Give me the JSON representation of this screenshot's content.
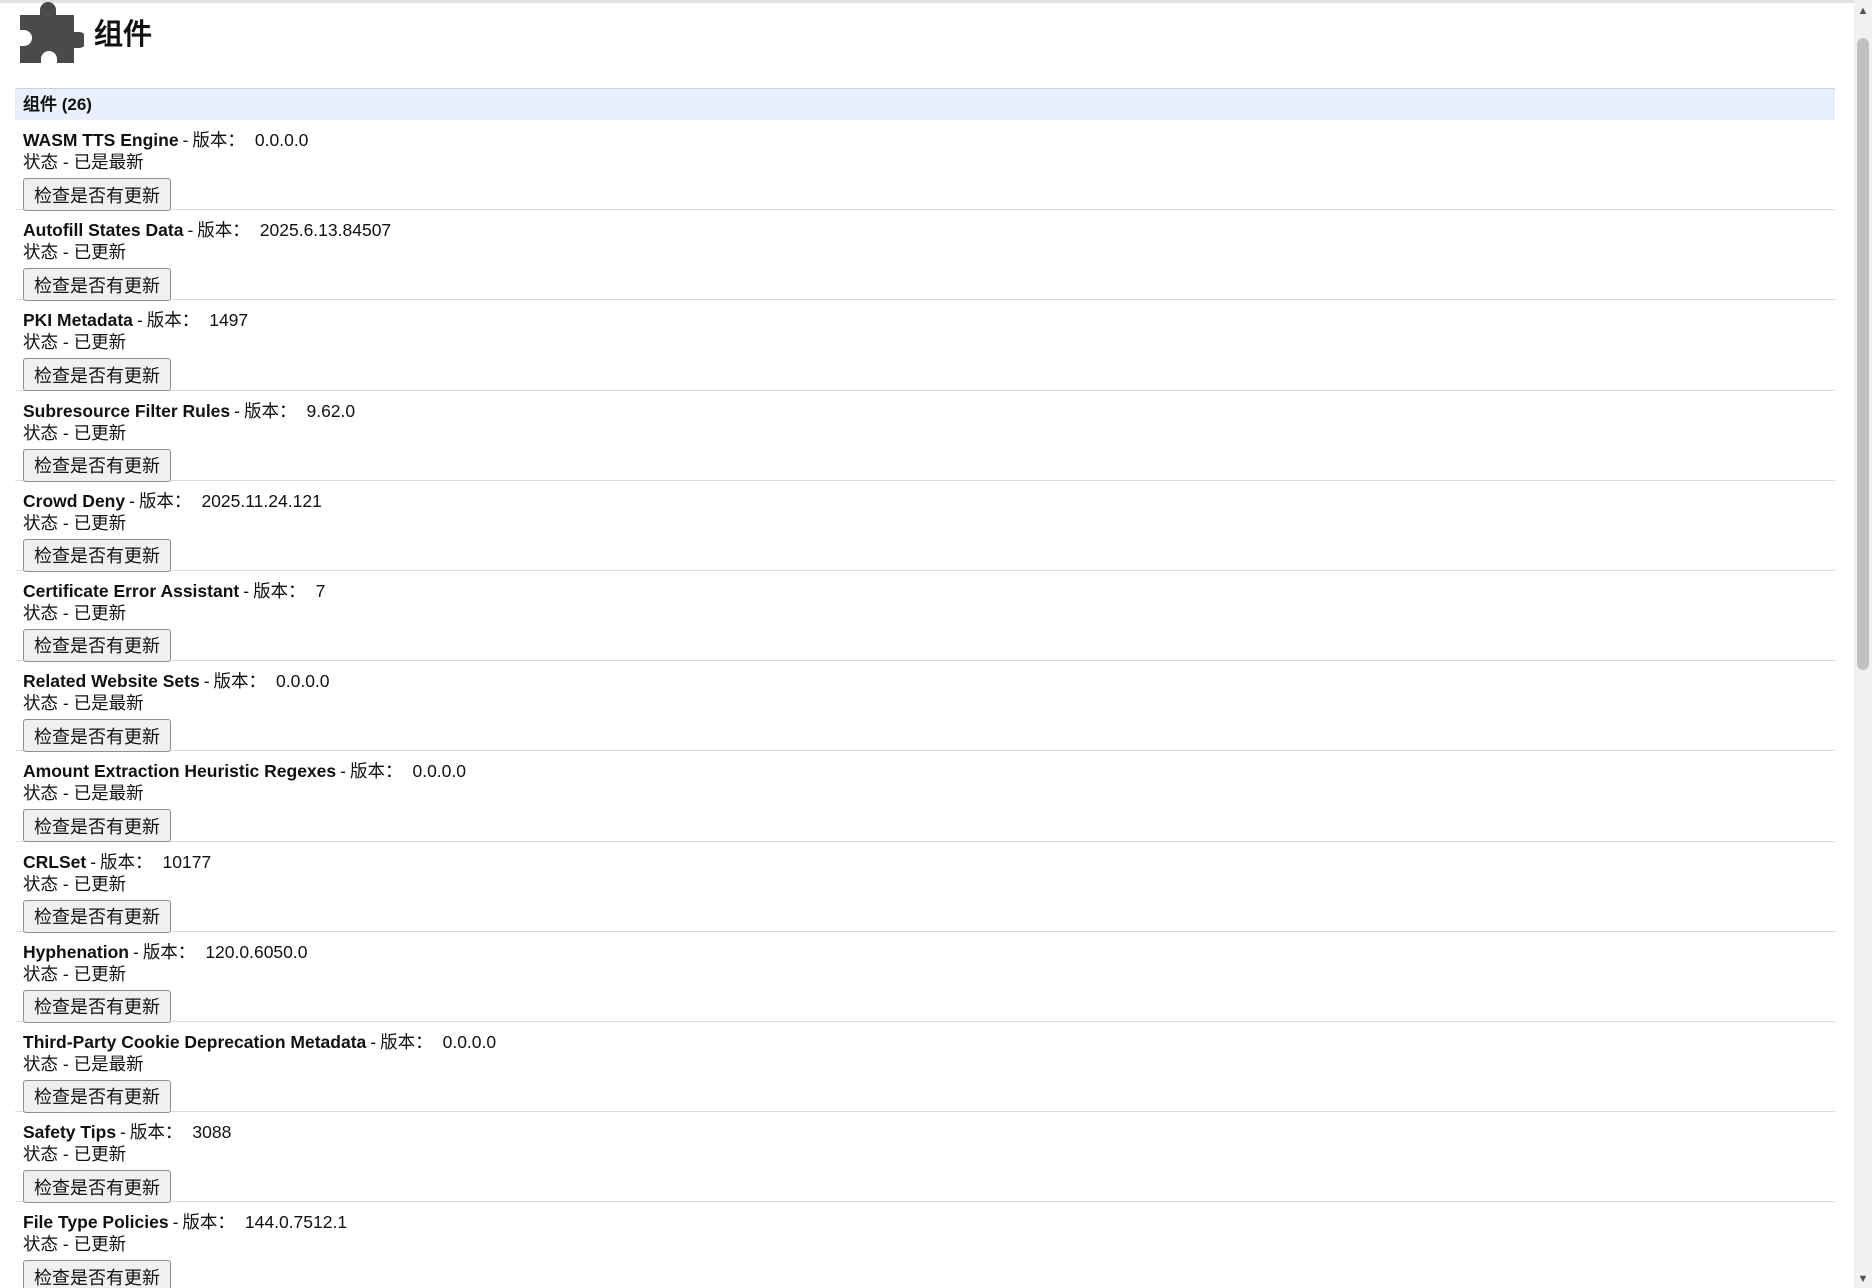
{
  "page": {
    "title": "组件",
    "section_title": "组件 (26)",
    "version_label": "版本：",
    "status_prefix": "状态 -",
    "check_button_label": "检查是否有更新"
  },
  "components": [
    {
      "name": "WASM TTS Engine",
      "version": "0.0.0.0",
      "status": "已是最新"
    },
    {
      "name": "Autofill States Data",
      "version": "2025.6.13.84507",
      "status": "已更新"
    },
    {
      "name": "PKI Metadata",
      "version": "1497",
      "status": "已更新"
    },
    {
      "name": "Subresource Filter Rules",
      "version": "9.62.0",
      "status": "已更新"
    },
    {
      "name": "Crowd Deny",
      "version": "2025.11.24.121",
      "status": "已更新"
    },
    {
      "name": "Certificate Error Assistant",
      "version": "7",
      "status": "已更新"
    },
    {
      "name": "Related Website Sets",
      "version": "0.0.0.0",
      "status": "已是最新"
    },
    {
      "name": "Amount Extraction Heuristic Regexes",
      "version": "0.0.0.0",
      "status": "已是最新"
    },
    {
      "name": "CRLSet",
      "version": "10177",
      "status": "已更新"
    },
    {
      "name": "Hyphenation",
      "version": "120.0.6050.0",
      "status": "已更新"
    },
    {
      "name": "Third-Party Cookie Deprecation Metadata",
      "version": "0.0.0.0",
      "status": "已是最新"
    },
    {
      "name": "Safety Tips",
      "version": "3088",
      "status": "已更新"
    },
    {
      "name": "File Type Policies",
      "version": "144.0.7512.1",
      "status": "已更新"
    }
  ],
  "icons": {
    "header": "puzzle-piece-icon",
    "scroll_up": "chevron-up-icon",
    "scroll_down": "chevron-down-icon"
  },
  "colors": {
    "section_header_bg": "#eaf0fb",
    "icon": "#4a4a4a"
  }
}
